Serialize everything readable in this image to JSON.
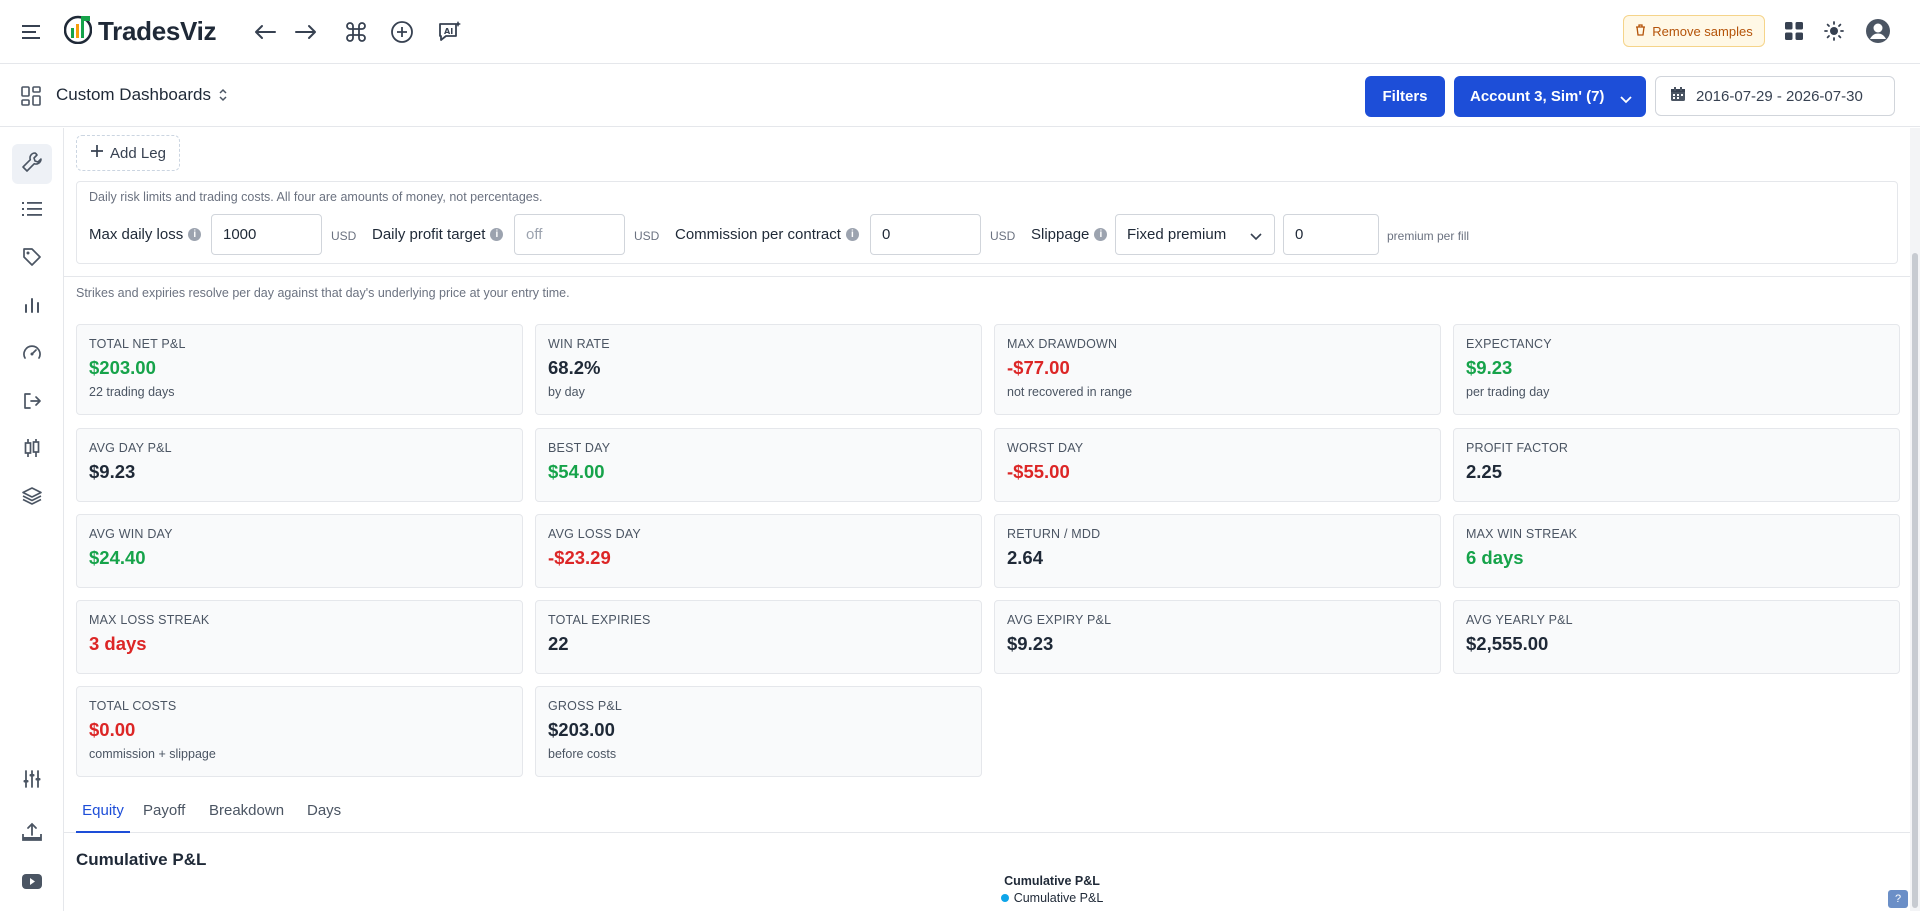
{
  "topbar": {
    "brand": "TradesViz",
    "remove_samples": "Remove samples"
  },
  "header": {
    "dashboard_title": "Custom Dashboards",
    "filters": "Filters",
    "account": "Account 3, Sim' (7)",
    "date_range": "2016-07-29 - 2026-07-30"
  },
  "builder": {
    "add_leg": "Add Leg",
    "risk_note": "Daily risk limits and trading costs. All four are amounts of money, not percentages.",
    "max_daily_loss_label": "Max daily loss",
    "max_daily_loss_value": "1000",
    "max_daily_loss_unit": "USD",
    "daily_profit_target_label": "Daily profit target",
    "daily_profit_target_placeholder": "off",
    "daily_profit_target_unit": "USD",
    "commission_label": "Commission per contract",
    "commission_value": "0",
    "commission_unit": "USD",
    "slippage_label": "Slippage",
    "slippage_mode": "Fixed premium",
    "slippage_value": "0",
    "slippage_unit": "premium per fill",
    "strike_note": "Strikes and expiries resolve per day against that day's underlying price at your entry time."
  },
  "stats": [
    {
      "label": "TOTAL NET P&L",
      "value": "$203.00",
      "sub": "22 trading days",
      "tone": "green"
    },
    {
      "label": "WIN RATE",
      "value": "68.2%",
      "sub": "by day",
      "tone": "neutral"
    },
    {
      "label": "MAX DRAWDOWN",
      "value": "-$77.00",
      "sub": "not recovered in range",
      "tone": "red"
    },
    {
      "label": "EXPECTANCY",
      "value": "$9.23",
      "sub": "per trading day",
      "tone": "green"
    },
    {
      "label": "AVG DAY P&L",
      "value": "$9.23",
      "sub": "",
      "tone": "neutral"
    },
    {
      "label": "BEST DAY",
      "value": "$54.00",
      "sub": "",
      "tone": "green"
    },
    {
      "label": "WORST DAY",
      "value": "-$55.00",
      "sub": "",
      "tone": "red"
    },
    {
      "label": "PROFIT FACTOR",
      "value": "2.25",
      "sub": "",
      "tone": "neutral"
    },
    {
      "label": "AVG WIN DAY",
      "value": "$24.40",
      "sub": "",
      "tone": "green"
    },
    {
      "label": "AVG LOSS DAY",
      "value": "-$23.29",
      "sub": "",
      "tone": "red"
    },
    {
      "label": "RETURN / MDD",
      "value": "2.64",
      "sub": "",
      "tone": "neutral"
    },
    {
      "label": "MAX WIN STREAK",
      "value": "6 days",
      "sub": "",
      "tone": "green"
    },
    {
      "label": "MAX LOSS STREAK",
      "value": "3 days",
      "sub": "",
      "tone": "red"
    },
    {
      "label": "TOTAL EXPIRIES",
      "value": "22",
      "sub": "",
      "tone": "neutral"
    },
    {
      "label": "AVG EXPIRY P&L",
      "value": "$9.23",
      "sub": "",
      "tone": "neutral"
    },
    {
      "label": "AVG YEARLY P&L",
      "value": "$2,555.00",
      "sub": "",
      "tone": "neutral"
    },
    {
      "label": "TOTAL COSTS",
      "value": "$0.00",
      "sub": "commission + slippage",
      "tone": "red"
    },
    {
      "label": "GROSS P&L",
      "value": "$203.00",
      "sub": "before costs",
      "tone": "neutral"
    }
  ],
  "tabs": [
    "Equity",
    "Payoff",
    "Breakdown",
    "Days"
  ],
  "chart": {
    "section_title": "Cumulative P&L",
    "title": "Cumulative P&L",
    "legend": "Cumulative P&L"
  },
  "help_badge": "?"
}
